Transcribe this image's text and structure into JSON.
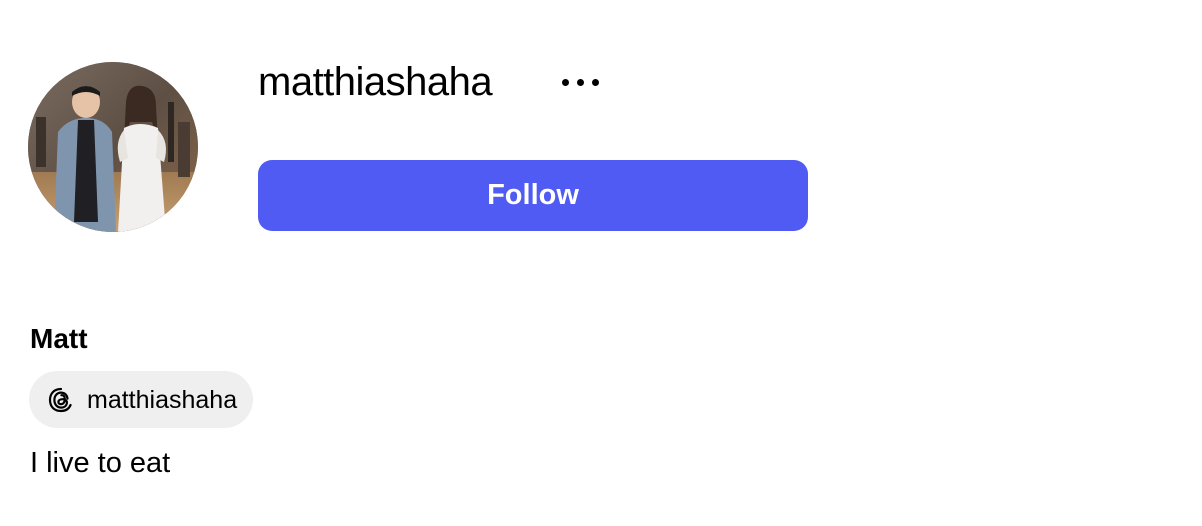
{
  "profile": {
    "username": "matthiashaha",
    "follow_label": "Follow",
    "display_name": "Matt",
    "threads_handle": "matthiashaha",
    "bio": "I live to eat"
  },
  "icons": {
    "more": "more-options-icon",
    "threads": "threads-icon"
  },
  "colors": {
    "follow_button": "#4f5bf2",
    "pill_background": "#efefef"
  }
}
